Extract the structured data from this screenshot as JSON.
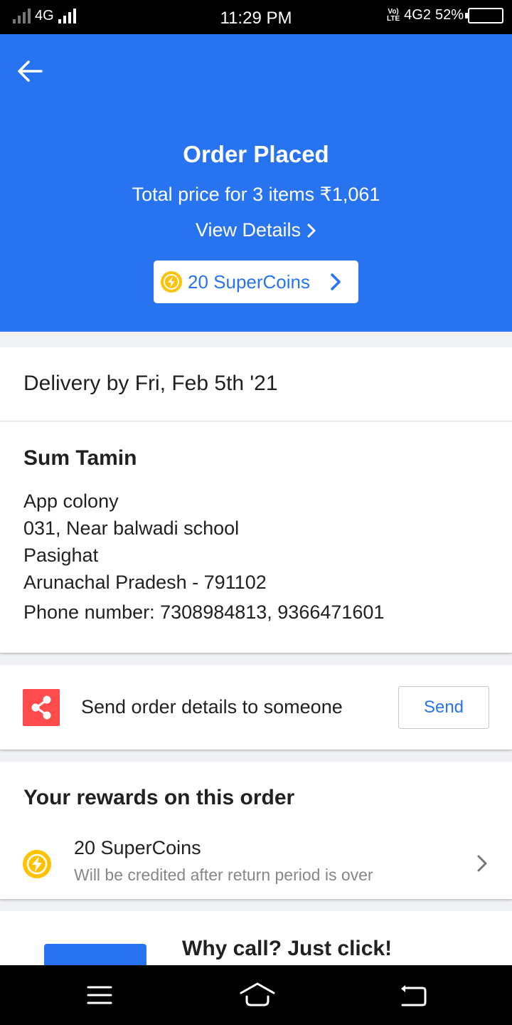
{
  "status_bar": {
    "network_left": "4G",
    "time": "11:29 PM",
    "volte_top": "Vo)",
    "volte_bottom": "LTE",
    "network_right": "4G2",
    "battery_pct": "52%",
    "battery_level": 0.52
  },
  "header": {
    "back_icon": "arrow-left-icon",
    "color": "#2874f0"
  },
  "order": {
    "title": "Order Placed",
    "total_text": "Total price for 3 items ₹1,061",
    "view_details": "View Details",
    "supercoins_pill": "20 SuperCoins"
  },
  "delivery": {
    "text": "Delivery by Fri, Feb 5th '21"
  },
  "address": {
    "name": "Sum Tamin",
    "lines": [
      "App colony",
      "031, Near balwadi school",
      "Pasighat",
      "Arunachal Pradesh - 791102"
    ],
    "phone": "Phone number: 7308984813, 9366471601"
  },
  "share": {
    "icon": "share-icon",
    "text": "Send order details to someone",
    "button": "Send"
  },
  "rewards": {
    "title": "Your rewards on this order",
    "item_name": "20 SuperCoins",
    "item_note": "Will be credited after return period is over"
  },
  "promo": {
    "title": "Why call? Just click!"
  },
  "colors": {
    "brand": "#2874f0",
    "coin": "#ffc200",
    "share_bg": "#ff4b4b"
  }
}
